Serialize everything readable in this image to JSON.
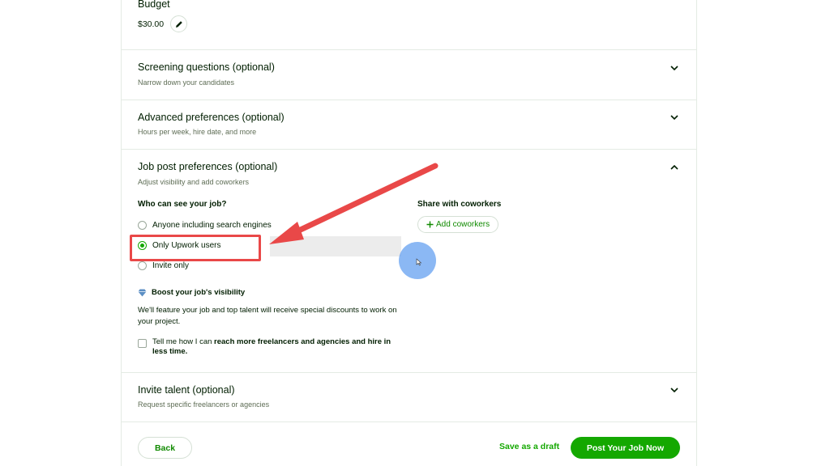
{
  "budget": {
    "title": "Budget",
    "value": "$30.00"
  },
  "screening": {
    "title": "Screening questions (optional)",
    "subtitle": "Narrow down your candidates"
  },
  "advanced": {
    "title": "Advanced preferences (optional)",
    "subtitle": "Hours per week, hire date, and more"
  },
  "job_post": {
    "title": "Job post preferences (optional)",
    "subtitle": "Adjust visibility and add coworkers",
    "visibility_label": "Who can see your job?",
    "options": [
      {
        "label": "Anyone including search engines",
        "checked": false
      },
      {
        "label": "Only Upwork users",
        "checked": true
      },
      {
        "label": "Invite only",
        "checked": false
      }
    ],
    "share_label": "Share with coworkers",
    "add_coworkers": "Add coworkers",
    "boost_title": "Boost your job's visibility",
    "boost_desc": "We'll feature your job and top talent will receive special discounts to work on your project.",
    "check_prefix": "Tell me how I can ",
    "check_bold": "reach more freelancers and agencies and hire in less time."
  },
  "invite": {
    "title": "Invite talent (optional)",
    "subtitle": "Request specific freelancers or agencies"
  },
  "footer": {
    "back": "Back",
    "draft": "Save as a draft",
    "post": "Post Your Job Now"
  },
  "colors": {
    "accent": "#14a800",
    "annotation": "#e94848",
    "cursor": "#64a0f0"
  },
  "icons": [
    "pencil-icon",
    "chevron-down-icon",
    "chevron-up-icon",
    "plus-icon",
    "diamond-icon"
  ]
}
